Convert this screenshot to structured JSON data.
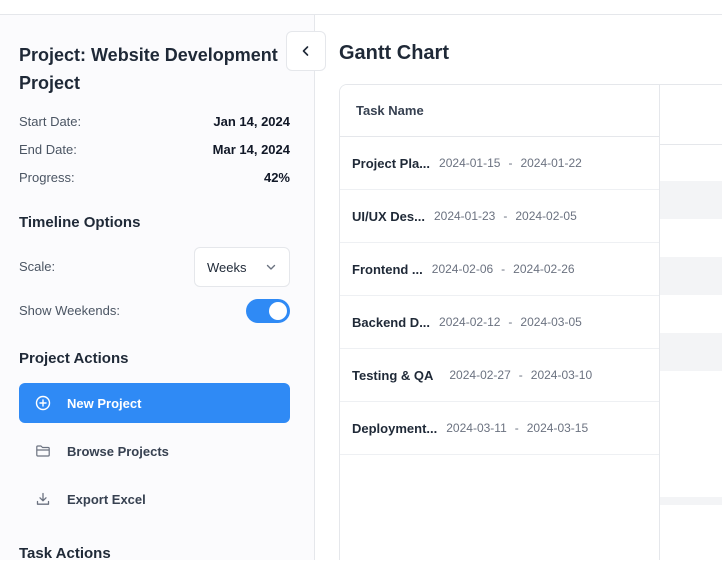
{
  "project": {
    "title": "Project: Website Development Project",
    "start_label": "Start Date:",
    "start_value": "Jan 14, 2024",
    "end_label": "End Date:",
    "end_value": "Mar 14, 2024",
    "progress_label": "Progress:",
    "progress_value": "42%"
  },
  "timeline_options": {
    "heading": "Timeline Options",
    "scale_label": "Scale:",
    "scale_value": "Weeks",
    "weekends_label": "Show Weekends:",
    "weekends_on": true
  },
  "project_actions": {
    "heading": "Project Actions",
    "items": [
      {
        "label": "New Project",
        "icon": "plus-circle-icon",
        "primary": true
      },
      {
        "label": "Browse Projects",
        "icon": "folder-icon",
        "primary": false
      },
      {
        "label": "Export Excel",
        "icon": "download-icon",
        "primary": false
      }
    ]
  },
  "task_actions": {
    "heading": "Task Actions"
  },
  "gantt": {
    "title": "Gantt Chart",
    "column_header": "Task Name",
    "tasks": [
      {
        "name": "Project Pla...",
        "start": "2024-01-15",
        "sep": "-",
        "end": "2024-01-22"
      },
      {
        "name": "UI/UX Des...",
        "start": "2024-01-23",
        "sep": "-",
        "end": "2024-02-05"
      },
      {
        "name": "Frontend ...",
        "start": "2024-02-06",
        "sep": "-",
        "end": "2024-02-26"
      },
      {
        "name": "Backend D...",
        "start": "2024-02-12",
        "sep": "-",
        "end": "2024-03-05"
      },
      {
        "name": "Testing & QA",
        "start": "2024-02-27",
        "sep": "-",
        "end": "2024-03-10"
      },
      {
        "name": "Deployment...",
        "start": "2024-03-11",
        "sep": "-",
        "end": "2024-03-15"
      }
    ]
  },
  "colors": {
    "accent": "#2f8af5",
    "stripe": "#f3f4f6",
    "border": "#e5e7eb"
  }
}
